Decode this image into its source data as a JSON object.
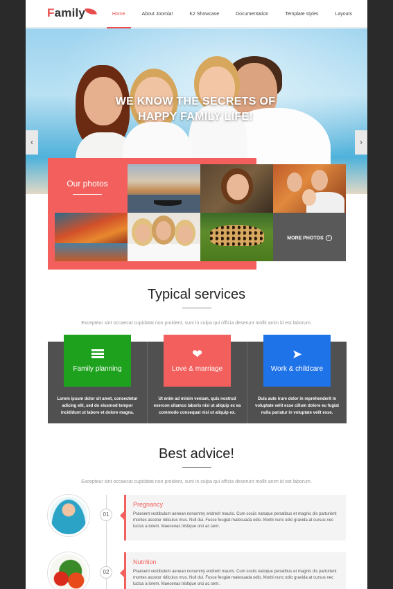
{
  "logo": {
    "first": "F",
    "rest": "amily"
  },
  "nav": [
    {
      "label": "Home",
      "active": true
    },
    {
      "label": "About Joomla!"
    },
    {
      "label": "K2 Showcase"
    },
    {
      "label": "Documentation"
    },
    {
      "label": "Template styles"
    },
    {
      "label": "Layouts"
    }
  ],
  "hero": {
    "line1": "WE KNOW THE SECRETS OF",
    "line2": "HAPPY FAMILY LIFE!"
  },
  "gallery": {
    "label": "Our photos",
    "more": "MORE PHOTOS"
  },
  "services": {
    "title": "Typical services",
    "subtitle": "Excepteur sint occaecat cupidatat non proident, sunt in culpa qui officia deserunt mollit anim id est laborum.",
    "items": [
      {
        "label": "Family planning",
        "icon": "list-icon",
        "color": "#1ea21e",
        "text": "Lorem ipsum dolor sit amet, consectetur adicing elit, sed do eiusmod tempor incididunt ut labore et dolore magna."
      },
      {
        "label": "Love & marriage",
        "icon": "heart-icon",
        "color": "#f25f5c",
        "text": "Ut enim ad minim veniam, quis nostrud exercon ullamco laboris nisi ut aliquip ex ea commodo consequat nisi ut aliquip ex."
      },
      {
        "label": "Work & childcare",
        "icon": "rocket-icon",
        "color": "#1f73e8",
        "text": "Duis aute irure dolor in reprehenderit in voluptate velit esse cillum dolore eu fugiat nulla pariatur in voluptate velit esse."
      }
    ]
  },
  "advice": {
    "title": "Best advice!",
    "subtitle": "Excepteur sint occaecat cupidatat non proident, sunt in culpa qui officia deserunt mollit anim id est laborum.",
    "items": [
      {
        "num": "01",
        "title": "Pregnancy",
        "text": "Praesent vestibulum aenean nonummy endrerit mauris. Cum sociis natoque penatibus et magnis dis parturient montes ascetur ridiculus mus. Null dui. Fusce feugiat malesuada odio. Morbi nunc odio gravida at cursus nec luctus a lorem. Maecenas tristique orci ac sem."
      },
      {
        "num": "02",
        "title": "Nutrition",
        "text": "Praesent vestibulum aenean nonummy endrerit mauris. Cum sociis natoque penatibus et magnis dis parturient montes ascetur ridiculus mus. Null dui. Fusce feugiat malesuada odio. Morbi nunc odio gravida at cursus nec luctus a lorem. Maecenas tristique orci ac sem."
      }
    ]
  }
}
